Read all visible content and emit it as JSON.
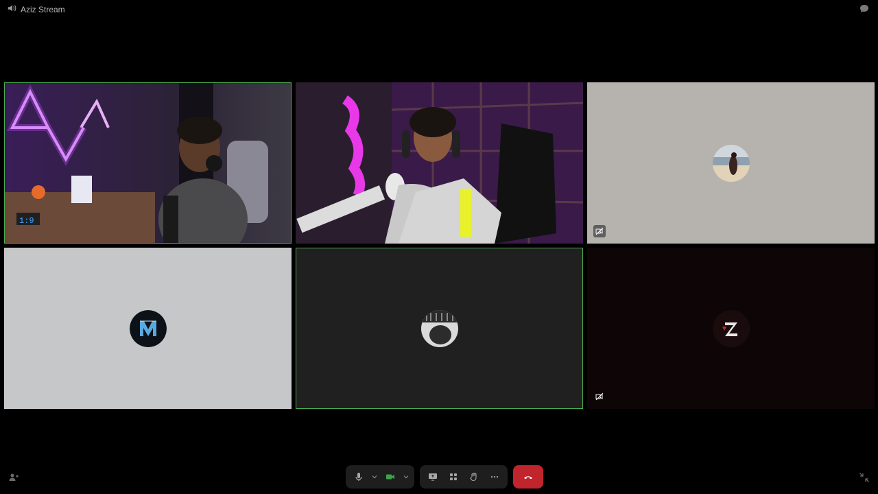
{
  "window": {
    "title": "Aziz Stream",
    "title_icon": "speaker-volume-icon"
  },
  "header": {
    "chat_icon": "chat-bubble-icon"
  },
  "participants": [
    {
      "tile": 1,
      "video": "on",
      "speaking": true,
      "scene": "person-with-headphones-purple-neon-room"
    },
    {
      "tile": 2,
      "video": "on",
      "speaking": false,
      "scene": "person-with-headphones-gaming-chair-microphone"
    },
    {
      "tile": 3,
      "video": "off",
      "speaking": false,
      "avatar": "photo-person-beach",
      "indicator_icon": "video-off-icon"
    },
    {
      "tile": 4,
      "video": "off",
      "speaking": false,
      "avatar": "letter-m-logo"
    },
    {
      "tile": 5,
      "video": "off",
      "speaking": true,
      "avatar": "black-white-photo"
    },
    {
      "tile": 6,
      "video": "off",
      "speaking": false,
      "avatar": "letter-z-logo",
      "indicator_icon": "video-off-icon"
    }
  ],
  "controls": {
    "mic_icon": "microphone-icon",
    "camera_icon": "camera-icon",
    "share_icon": "screen-share-icon",
    "apps_icon": "apps-grid-icon",
    "reactions_icon": "raise-hand-icon",
    "more_icon": "more-icon",
    "hangup_icon": "phone-hangup-icon",
    "participants_icon": "participants-icon",
    "minimize_icon": "minimize-icon"
  },
  "colors": {
    "background": "#000000",
    "speaking_border": "#4caf50",
    "hangup": "#c0242c",
    "camera_active": "#3fa34d"
  }
}
